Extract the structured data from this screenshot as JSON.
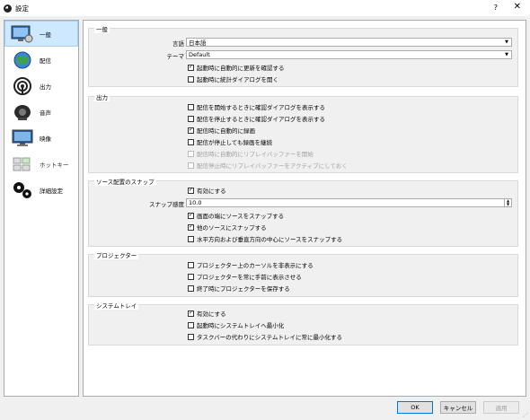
{
  "window": {
    "title": "設定",
    "help": "?",
    "close": "✕"
  },
  "sidebar": {
    "items": [
      {
        "label": "一般",
        "active": true
      },
      {
        "label": "配信"
      },
      {
        "label": "出力"
      },
      {
        "label": "音声"
      },
      {
        "label": "映像"
      },
      {
        "label": "ホットキー"
      },
      {
        "label": "詳細設定"
      }
    ]
  },
  "general": {
    "title": "一般",
    "language_label": "言語",
    "language_value": "日本語",
    "theme_label": "テーマ",
    "theme_value": "Default",
    "check_updates": "起動時に自動的に更新を確認する",
    "open_stats": "起動時に統計ダイアログを開く"
  },
  "output": {
    "title": "出力",
    "confirm_start": "配信を開始するときに確認ダイアログを表示する",
    "confirm_stop": "配信を停止するときに確認ダイアログを表示する",
    "auto_record": "配信時に自動的に録画",
    "keep_recording": "配信が停止しても録画を継続",
    "replay_start": "配信時に自動的にリプレイバッファーを開始",
    "replay_keep": "配信停止時にリプレイバッファーをアクティブにしておく"
  },
  "snapping": {
    "title": "ソース配置のスナップ",
    "enable": "有効にする",
    "sensitivity_label": "スナップ感度",
    "sensitivity_value": "10.0",
    "screen_edge": "画面の端にソースをスナップする",
    "other_sources": "他のソースにスナップする",
    "center": "水平方向および垂直方向の中心にソースをスナップする"
  },
  "projector": {
    "title": "プロジェクター",
    "hide_cursor": "プロジェクター上のカーソルを非表示にする",
    "always_on_top": "プロジェクターを常に手前に表示させる",
    "save_on_exit": "終了時にプロジェクターを保存する"
  },
  "tray": {
    "title": "システムトレイ",
    "enable": "有効にする",
    "minimize_start": "起動時にシステムトレイへ最小化",
    "minimize_always": "タスクバーの代わりにシステムトレイに常に最小化する"
  },
  "footer": {
    "ok": "OK",
    "cancel": "キャンセル",
    "apply": "適用"
  },
  "check_mark": "✓"
}
